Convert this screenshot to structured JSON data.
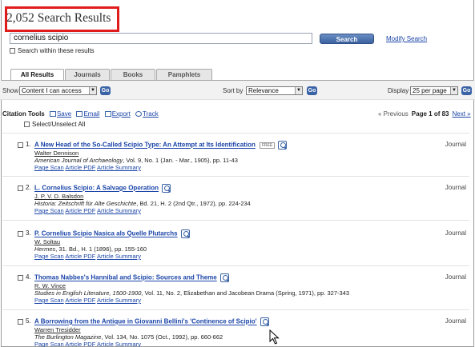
{
  "header": {
    "results_count": "2,052 Search Results",
    "highlight_color": "#e01b1b"
  },
  "search": {
    "query": "cornelius scipio",
    "button_label": "Search",
    "modify_label": "Modify Search",
    "within_label": "Search within these results"
  },
  "tabs": [
    {
      "label": "All Results",
      "active": true
    },
    {
      "label": "Journals",
      "active": false
    },
    {
      "label": "Books",
      "active": false
    },
    {
      "label": "Pamphlets",
      "active": false
    }
  ],
  "controls": {
    "show_label": "Show",
    "show_value": "Content I can access",
    "sort_label": "Sort by",
    "sort_value": "Relevance",
    "display_label": "Display",
    "display_value": "25 per page",
    "go_label": "Go"
  },
  "citation_tools": {
    "label": "Citation Tools",
    "save": "Save",
    "email": "Email",
    "export": "Export",
    "track": "Track",
    "select_all": "Select/Unselect All"
  },
  "pager": {
    "previous": "« Previous",
    "current": "Page 1 of 83",
    "next": "Next »"
  },
  "results": [
    {
      "num": "1.",
      "title": "A New Head of the So-Called Scipio Type: An Attempt at Its Identification",
      "free": "FREE",
      "author": "Walter Dennison",
      "journal": "American Journal of Archaeology",
      "details": ", Vol. 9, No. 1 (Jan. - Mar., 1905), pp. 11-43",
      "type": "Journal"
    },
    {
      "num": "2.",
      "title": "L. Cornelius Scipio: A Salvage Operation",
      "author": "J. P. V. D. Balsdon",
      "journal": "Historia: Zeitschrift für Alte Geschichte",
      "details": ", Bd. 21, H. 2 (2nd Qtr., 1972), pp. 224-234",
      "type": "Journal"
    },
    {
      "num": "3.",
      "title": "P. Cornelius Scipio Nasica als Quelle Plutarchs",
      "author": "W. Soltau",
      "journal": "Hermes",
      "details": ", 31. Bd., H. 1 (1896), pp. 155-160",
      "type": "Journal"
    },
    {
      "num": "4.",
      "title": "Thomas Nabbes's Hannibal and Scipio: Sources and Theme",
      "author": "R. W. Vince",
      "journal": "Studies in English Literature, 1500-1900",
      "details": ", Vol. 11, No. 2, Elizabethan and Jacobean Drama (Spring, 1971), pp. 327-343",
      "type": "Journal"
    },
    {
      "num": "5.",
      "title": "A Borrowing from the Antique in Giovanni Bellini's 'Continence of Scipio'",
      "author": "Warren Tresidder",
      "journal": "The Burlington Magazine",
      "details": ", Vol. 134, No. 1075 (Oct., 1992), pp. 660-662",
      "type": "Journal"
    }
  ],
  "result_links": {
    "page_scan": "Page Scan",
    "article_pdf": "Article PDF",
    "article_summary": "Article Summary"
  }
}
